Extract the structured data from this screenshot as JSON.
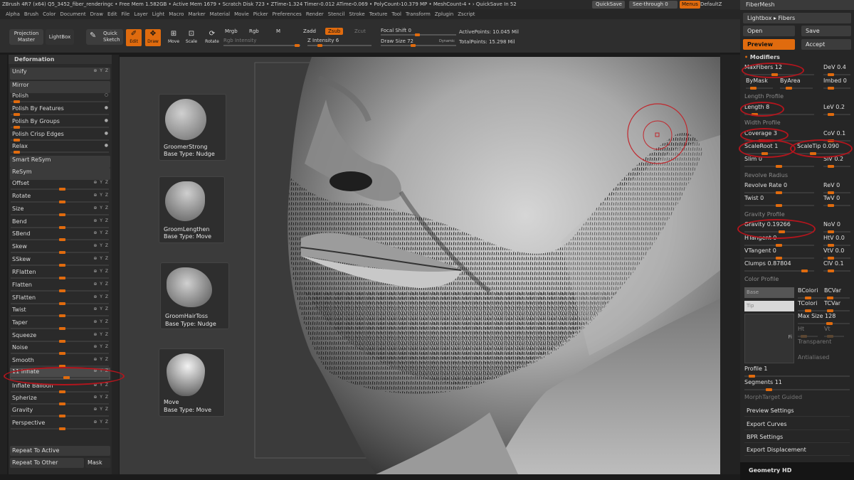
{
  "titlebar": {
    "left": "ZBrush 4R7 (x64)   Q5_3452_fiber_renderingc   • Free Mem 1.582GB • Active Mem 1679 • Scratch Disk 723 •  ZTime›1.324 Timer›0.012 ATime›0.069 • PolyCount›10.379 MP • MeshCount›4 • › QuickSave In 52",
    "quicksave": "QuickSave",
    "seethrough": "See-through  0",
    "menus": "Menus",
    "default": "DefaultZ"
  },
  "menubar": [
    "Alpha",
    "Brush",
    "Color",
    "Document",
    "Draw",
    "Edit",
    "File",
    "Layer",
    "Light",
    "Macro",
    "Marker",
    "Material",
    "Movie",
    "Picker",
    "Preferences",
    "Render",
    "Stencil",
    "Stroke",
    "Texture",
    "Tool",
    "Transform",
    "Zplugin",
    "Zscript"
  ],
  "toolshelf": {
    "projection_master": "Projection Master",
    "lightbox": "LightBox",
    "quick_sketch": "Quick Sketch",
    "edit": "Edit",
    "draw": "Draw",
    "move": "Move",
    "scale": "Scale",
    "rotate": "Rotate",
    "mrgb": "Mrgb",
    "rgb": "Rgb",
    "m": "M",
    "rgb_intensity": "Rgb Intensity",
    "zadd": "Zadd",
    "zsub": "Zsub",
    "zcut": "Zcut",
    "z_intensity": "Z Intensity 6",
    "focal_shift": "Focal Shift 0",
    "draw_size": "Draw Size 72",
    "dynamic": "Dynamic",
    "active_points": "ActivePoints: 10.045 Mil",
    "total_points": "TotalPoints: 15.298 Mil"
  },
  "left_panel": {
    "header": "Deformation",
    "rows": [
      {
        "label": "Unify",
        "type": "button",
        "icons": "⊕ Y Z"
      },
      {
        "label": "Mirror",
        "type": "button",
        "icons": ""
      },
      {
        "label": "Polish",
        "type": "slider",
        "icons": "○"
      },
      {
        "label": "Polish By Features",
        "type": "slider",
        "icons": "●"
      },
      {
        "label": "Polish By Groups",
        "type": "slider",
        "icons": "●"
      },
      {
        "label": "Polish Crisp Edges",
        "type": "slider",
        "icons": "●"
      },
      {
        "label": "Relax",
        "type": "slider",
        "icons": "●"
      },
      {
        "label": "Smart ReSym",
        "type": "button",
        "icons": ""
      },
      {
        "label": "ReSym",
        "type": "button",
        "icons": ""
      },
      {
        "label": "Offset",
        "type": "slider",
        "icons": "⊕ Y Z"
      },
      {
        "label": "Rotate",
        "type": "slider",
        "icons": "⊕ Y Z"
      },
      {
        "label": "Size",
        "type": "slider",
        "icons": "⊕ Y Z"
      },
      {
        "label": "Bend",
        "type": "slider",
        "icons": "⊕ Y Z"
      },
      {
        "label": "SBend",
        "type": "slider",
        "icons": "⊕ Y Z"
      },
      {
        "label": "Skew",
        "type": "slider",
        "icons": "⊕ Y Z"
      },
      {
        "label": "SSkew",
        "type": "slider",
        "icons": "⊕ Y Z"
      },
      {
        "label": "RFlatten",
        "type": "slider",
        "icons": "⊕ Y Z"
      },
      {
        "label": "Flatten",
        "type": "slider",
        "icons": "⊕ Y Z"
      },
      {
        "label": "SFlatten",
        "type": "slider",
        "icons": "⊕ Y Z"
      },
      {
        "label": "Twist",
        "type": "slider",
        "icons": "⊕ Y Z"
      },
      {
        "label": "Taper",
        "type": "slider",
        "icons": "⊕ Y Z"
      },
      {
        "label": "Squeeze",
        "type": "slider",
        "icons": "⊕ Y Z"
      },
      {
        "label": "Noise",
        "type": "slider",
        "icons": "⊕ Y Z"
      },
      {
        "label": "Smooth",
        "type": "slider",
        "icons": "⊕ Y Z"
      },
      {
        "label": "11 Inflate",
        "type": "selected",
        "icons": "⊕ Y Z"
      },
      {
        "label": "Inflate Balloon",
        "type": "slider",
        "icons": "⊕ Y Z"
      },
      {
        "label": "Spherize",
        "type": "slider",
        "icons": "⊕ Y Z"
      },
      {
        "label": "Gravity",
        "type": "slider",
        "icons": "⊕ Y Z"
      },
      {
        "label": "Perspective",
        "type": "slider",
        "icons": "⊕ Y Z"
      }
    ],
    "repeat_to_active": "Repeat To Active",
    "repeat_to_other": "Repeat To Other",
    "mask": "Mask"
  },
  "brushes": [
    {
      "name": "GroomerStrong",
      "type": "Base Type: Nudge"
    },
    {
      "name": "GroomLengthen",
      "type": "Base Type: Move"
    },
    {
      "name": "GroomHairToss",
      "type": "Base Type: Nudge"
    },
    {
      "name": "Move",
      "type": "Base Type: Move"
    }
  ],
  "right_panel": {
    "title": "FiberMesh",
    "lightbox_fibers": "Lightbox ▸ Fibers",
    "open": "Open",
    "save": "Save",
    "preview": "Preview",
    "accept": "Accept",
    "modifiers": "Modifiers",
    "max_fibers": "MaxFibers 12",
    "dev": "DeV 0.4",
    "by_mask": "ByMask",
    "by_area": "ByArea",
    "imbed": "Imbed 0",
    "length_profile": "Length Profile",
    "length": "Length 8",
    "lev": "LeV 0.2",
    "width_profile": "Width Profile",
    "coverage": "Coverage 3",
    "cov": "CoV 0.1",
    "scale_root": "ScaleRoot 1",
    "scale_tip": "ScaleTip 0.090",
    "slim": "Slim 0",
    "slv": "SlV 0.2",
    "revolve_radius": "Revolve Radius",
    "revolve_rate": "Revolve Rate 0",
    "rev": "ReV 0",
    "twist": "Twist 0",
    "twv": "TwV 0",
    "gravity_profile": "Gravity Profile",
    "gravity": "Gravity 0.19266",
    "nov": "NoV 0",
    "htangent": "HTangent 0",
    "htv": "HtV 0.0",
    "vtangent": "VTangent 0",
    "vtv": "VtV 0.0",
    "clumps": "Clumps 0.87804",
    "clv": "ClV 0.1",
    "color_profile": "Color Profile",
    "base": "Base",
    "tip": "Tip",
    "bcolori": "BColori",
    "bcvar": "BCVar",
    "tcolori": "TColori",
    "tcvar": "TCVar",
    "max_size": "Max Size 128",
    "ht": "Ht",
    "vt": "Vt",
    "transparent": "Transparent",
    "antialiased": "Antialiased",
    "fi": "Fi",
    "profile": "Profile 1",
    "segments": "Segments 11",
    "morph_target_guided": "MorphTarget Guided",
    "preview_settings": "Preview Settings",
    "export_curves": "Export Curves",
    "bpr_settings": "BPR Settings",
    "export_displacement": "Export Displacement",
    "geometry_hd": "Geometry HD"
  },
  "colors": {
    "accent": "#e06b0e",
    "annotation": "#b3151d"
  }
}
